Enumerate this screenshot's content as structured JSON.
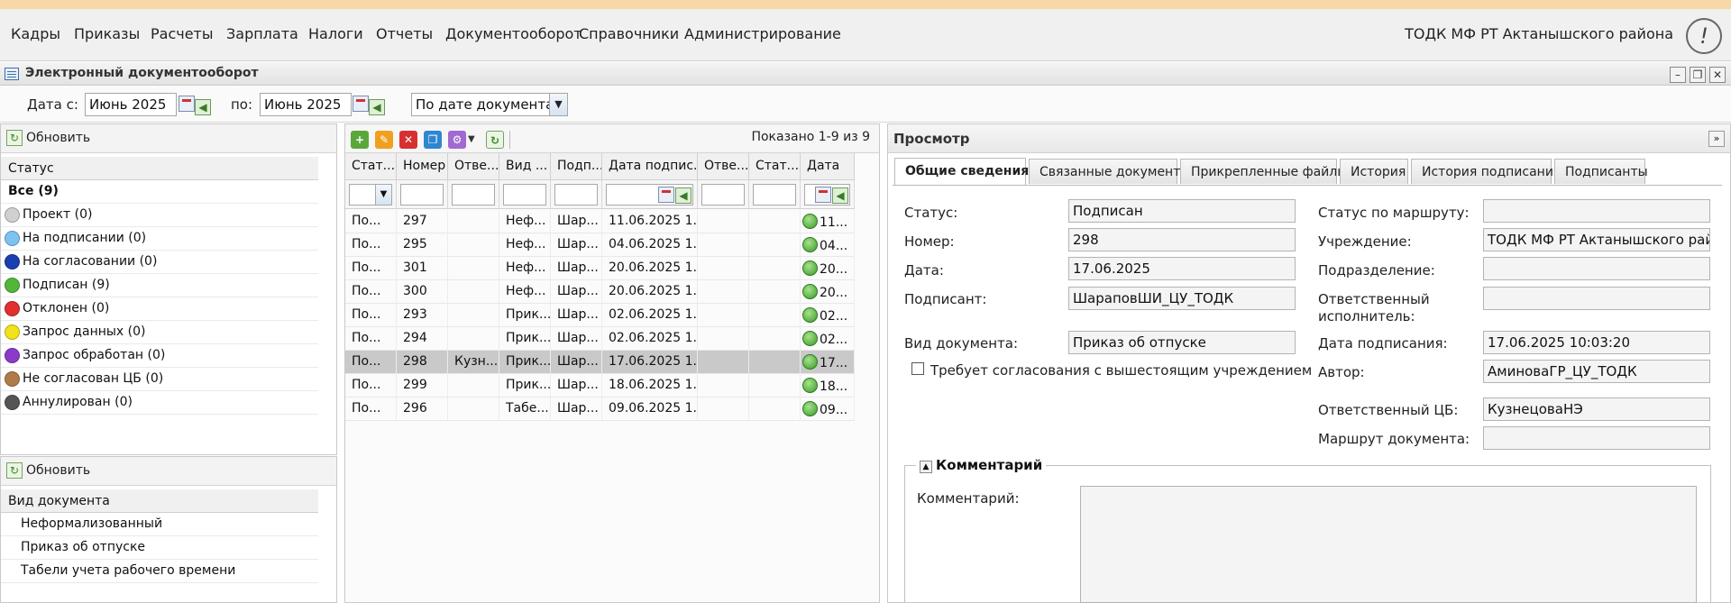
{
  "menu": {
    "items": [
      "Кадры",
      "Приказы",
      "Расчеты",
      "Зарплата",
      "Налоги",
      "Отчеты",
      "Документооборот",
      "Справочники",
      "Администрирование"
    ],
    "org": "ТОДК МФ РТ Актанышского района"
  },
  "window": {
    "title": "Электронный документооборот"
  },
  "filter": {
    "date_from_label": "Дата с:",
    "date_from": "Июнь 2025",
    "date_to_label": "по:",
    "date_to": "Июнь 2025",
    "sort": "По дате документа"
  },
  "status_panel": {
    "refresh_label": "Обновить",
    "header": "Статус",
    "items": [
      {
        "label": "Все (9)"
      },
      {
        "label": "Проект (0)",
        "color": "#d0d0d0"
      },
      {
        "label": "На подписании (0)",
        "color": "#7cc3f0"
      },
      {
        "label": "На согласовании (0)",
        "color": "#1a3fb0"
      },
      {
        "label": "Подписан (9)",
        "color": "#52b63a"
      },
      {
        "label": "Отклонен (0)",
        "color": "#e03030"
      },
      {
        "label": "Запрос данных (0)",
        "color": "#f2e21a"
      },
      {
        "label": "Запрос обработан (0)",
        "color": "#8a3cc8"
      },
      {
        "label": "Не согласован ЦБ (0)",
        "color": "#b07a4a"
      },
      {
        "label": "Аннулирован (0)",
        "color": "#555555"
      }
    ]
  },
  "doctype_panel": {
    "refresh_label": "Обновить",
    "header": "Вид документа",
    "items": [
      "Неформализованный",
      "Приказ об отпуске",
      "Табели учета рабочего времени"
    ]
  },
  "grid": {
    "shown": "Показано 1-9 из 9",
    "columns": [
      "Стат...",
      "Номер",
      "Отве...",
      "Вид ...",
      "Подп...",
      "Дата подпис...",
      "Отве...",
      "Стат...",
      "Дата"
    ],
    "rows": [
      [
        "По...",
        "297",
        "",
        "Неф...",
        "Шар...",
        "11.06.2025 1...",
        "",
        "",
        "11..."
      ],
      [
        "По...",
        "295",
        "",
        "Неф...",
        "Шар...",
        "04.06.2025 1...",
        "",
        "",
        "04..."
      ],
      [
        "По...",
        "301",
        "",
        "Неф...",
        "Шар...",
        "20.06.2025 1...",
        "",
        "",
        "20..."
      ],
      [
        "По...",
        "300",
        "",
        "Неф...",
        "Шар...",
        "20.06.2025 1...",
        "",
        "",
        "20..."
      ],
      [
        "По...",
        "293",
        "",
        "Прик...",
        "Шар...",
        "02.06.2025 1...",
        "",
        "",
        "02..."
      ],
      [
        "По...",
        "294",
        "",
        "Прик...",
        "Шар...",
        "02.06.2025 1...",
        "",
        "",
        "02..."
      ],
      [
        "По...",
        "298",
        "Кузн...",
        "Прик...",
        "Шар...",
        "17.06.2025 1...",
        "",
        "",
        "17..."
      ],
      [
        "По...",
        "299",
        "",
        "Прик...",
        "Шар...",
        "18.06.2025 1...",
        "",
        "",
        "18..."
      ],
      [
        "По...",
        "296",
        "",
        "Табе...",
        "Шар...",
        "09.06.2025 1...",
        "",
        "",
        "09..."
      ]
    ]
  },
  "preview": {
    "title": "Просмотр",
    "tabs": [
      "Общие сведения",
      "Связанные документы",
      "Прикрепленные файлы",
      "История",
      "История подписания",
      "Подписанты"
    ],
    "left": {
      "status_label": "Статус:",
      "status": "Подписан",
      "number_label": "Номер:",
      "number": "298",
      "date_label": "Дата:",
      "date": "17.06.2025",
      "signer_label": "Подписант:",
      "signer": "ШараповШИ_ЦУ_ТОДК",
      "doctype_label": "Вид документа:",
      "doctype": "Приказ об отпуске",
      "checkbox_label": "Требует согласования с вышестоящим учреждением"
    },
    "right": {
      "route_status_label": "Статус по маршруту:",
      "route_status": "",
      "institution_label": "Учреждение:",
      "institution": "ТОДК МФ РТ Актанышского района",
      "division_label": "Подразделение:",
      "division": "",
      "executor_label": "Ответственный исполнитель:",
      "executor": "",
      "sign_date_label": "Дата подписания:",
      "sign_date": "17.06.2025 10:03:20",
      "author_label": "Автор:",
      "author": "АминоваГР_ЦУ_ТОДК",
      "cb_label": "Ответственный ЦБ:",
      "cb": "КузнецоваНЭ",
      "route_label": "Маршрут документа:",
      "route": ""
    },
    "comment": {
      "section": "Комментарий",
      "label": "Комментарий:"
    }
  }
}
